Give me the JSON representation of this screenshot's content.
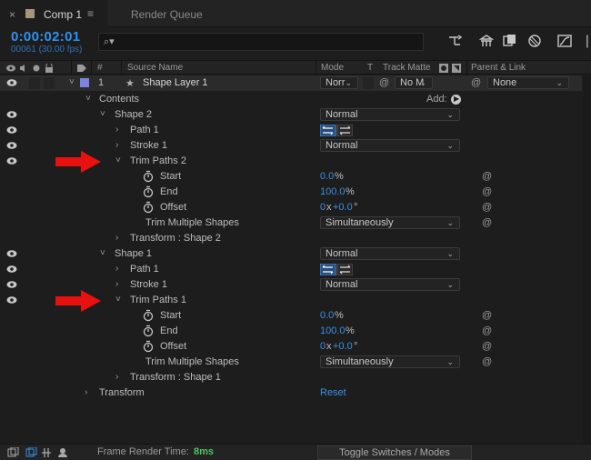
{
  "tab": {
    "close": "×",
    "title": "Comp 1",
    "menu": "≡",
    "render_queue": "Render Queue"
  },
  "header": {
    "timecode": "0:00:02:01",
    "frame_info": "00061 (30.00 fps)",
    "search_glyph": "⌕▾",
    "overflow": "❘"
  },
  "columns": {
    "num": "#",
    "source_name": "Source Name",
    "mode": "Mode",
    "t": "T",
    "track_matte": "Track Matte",
    "parent": "Parent & Link"
  },
  "layer": {
    "number": "1",
    "star": "★",
    "name": "Shape Layer 1",
    "mode": "Norr",
    "matte": "No M",
    "parent": "None",
    "label_color": "#7a85e0"
  },
  "contents": {
    "label": "Contents",
    "add_label": "Add:"
  },
  "shape2": {
    "label": "Shape 2",
    "blend": "Normal",
    "path_label": "Path 1",
    "stroke_label": "Stroke 1",
    "stroke_blend": "Normal",
    "trim_label": "Trim Paths 2",
    "start_label": "Start",
    "start_value": "0.0",
    "start_unit": "%",
    "end_label": "End",
    "end_value": "100.0",
    "end_unit": "%",
    "offset_label": "Offset",
    "offset_rev": "0",
    "offset_x": "x",
    "offset_deg": "+0.0",
    "offset_unit": "°",
    "tms_label": "Trim Multiple Shapes",
    "tms_value": "Simultaneously",
    "transform_label": "Transform : Shape 2"
  },
  "shape1": {
    "label": "Shape 1",
    "blend": "Normal",
    "path_label": "Path 1",
    "stroke_label": "Stroke 1",
    "stroke_blend": "Normal",
    "trim_label": "Trim Paths 1",
    "start_label": "Start",
    "start_value": "0.0",
    "start_unit": "%",
    "end_label": "End",
    "end_value": "100.0",
    "end_unit": "%",
    "offset_label": "Offset",
    "offset_rev": "0",
    "offset_x": "x",
    "offset_deg": "+0.0",
    "offset_unit": "°",
    "tms_label": "Trim Multiple Shapes",
    "tms_value": "Simultaneously",
    "transform_label": "Transform : Shape 1"
  },
  "transform": {
    "label": "Transform",
    "reset": "Reset"
  },
  "glyphs": {
    "twirl_open": "˅",
    "twirl_closed": "›",
    "spiral": "@",
    "chev": "⌄",
    "play": "▶"
  },
  "footer": {
    "frame_render_label": "Frame Render Time:",
    "frame_render_value": "8ms",
    "toggle_label": "Toggle Switches / Modes"
  },
  "colors": {
    "accent_blue": "#3b8fe6",
    "render_green": "#50c260",
    "arrow_red": "#e8110f"
  }
}
